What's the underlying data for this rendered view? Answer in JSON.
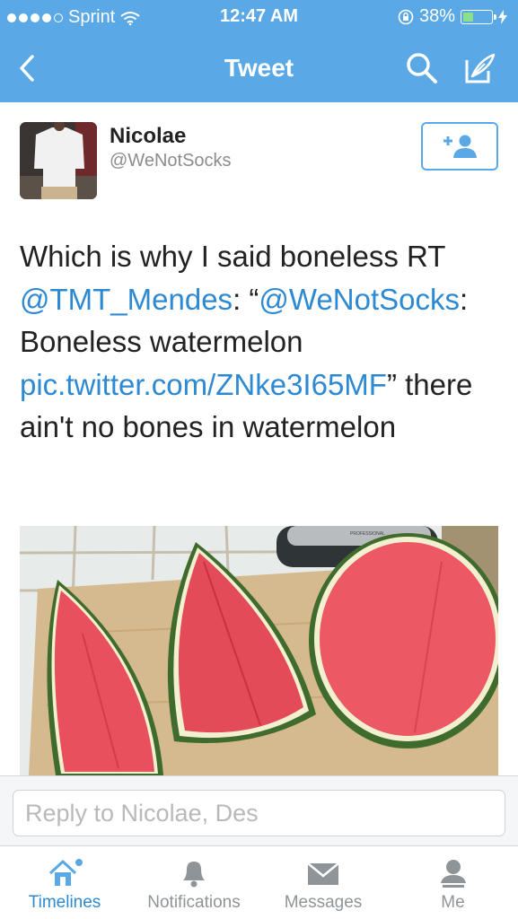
{
  "status_bar": {
    "carrier": "Sprint",
    "time": "12:47 AM",
    "battery": "38%",
    "battery_level": 0.38
  },
  "nav": {
    "title": "Tweet"
  },
  "tweet": {
    "author_name": "Nicolae",
    "author_handle": "@WeNotSocks",
    "text_part1": "Which is why I said boneless RT ",
    "mention1": "@TMT_Mendes",
    "text_part2": ": “",
    "mention2": "@WeNotSocks",
    "text_part3": ": Boneless watermelon ",
    "link": "pic.twitter.com/ZNke3I65MF",
    "text_part4": "” there ain't no bones in watermelon"
  },
  "photo": {
    "appliance_label": "PROFESSIONAL"
  },
  "reply": {
    "placeholder": "Reply to Nicolae, Des"
  },
  "tabs": [
    {
      "label": "Timelines",
      "active": true
    },
    {
      "label": "Notifications",
      "active": false
    },
    {
      "label": "Messages",
      "active": false
    },
    {
      "label": "Me",
      "active": false
    }
  ],
  "colors": {
    "brand_blue": "#5aa9e6",
    "link_blue": "#2d89d1",
    "battery_green": "#8de08a"
  }
}
